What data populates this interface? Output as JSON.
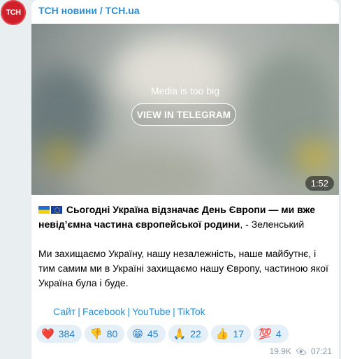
{
  "channel": {
    "avatar_text": "TCH",
    "name": "ТСН новини / TCH.ua"
  },
  "media": {
    "notice": "Media is too big",
    "button_label": "VIEW IN TELEGRAM",
    "duration": "1:52"
  },
  "post": {
    "bold_text": "Сьогодні Україна відзначає День Європи — ми вже невід’ємна частина європейської родини",
    "after_bold": ", - Зеленський",
    "paragraph2": "Ми захищаємо Україну, нашу незалежність, наше майбутнє, і тим самим ми в Україні захищаємо нашу Європу, частиною якої Україна була і буде."
  },
  "links": {
    "site": "Сайт",
    "facebook": "Facebook",
    "youtube": "YouTube",
    "tiktok": "TikTok",
    "separator": "|"
  },
  "reactions": [
    {
      "emoji": "❤️",
      "icon": "heart-icon",
      "count": "384"
    },
    {
      "emoji": "👎",
      "icon": "thumbs-down-icon",
      "count": "80"
    },
    {
      "emoji": "😁",
      "icon": "grin-icon",
      "count": "45"
    },
    {
      "emoji": "🙏",
      "icon": "pray-icon",
      "count": "22"
    },
    {
      "emoji": "👍",
      "icon": "thumbs-up-icon",
      "count": "17"
    },
    {
      "emoji": "💯",
      "icon": "hundred-icon",
      "count": "4"
    }
  ],
  "meta": {
    "views": "19.9K",
    "time": "07:21"
  },
  "colors": {
    "accent": "#2b8fd6",
    "avatar": "#cf1f2a",
    "reaction_bg": "#e4eff8"
  }
}
